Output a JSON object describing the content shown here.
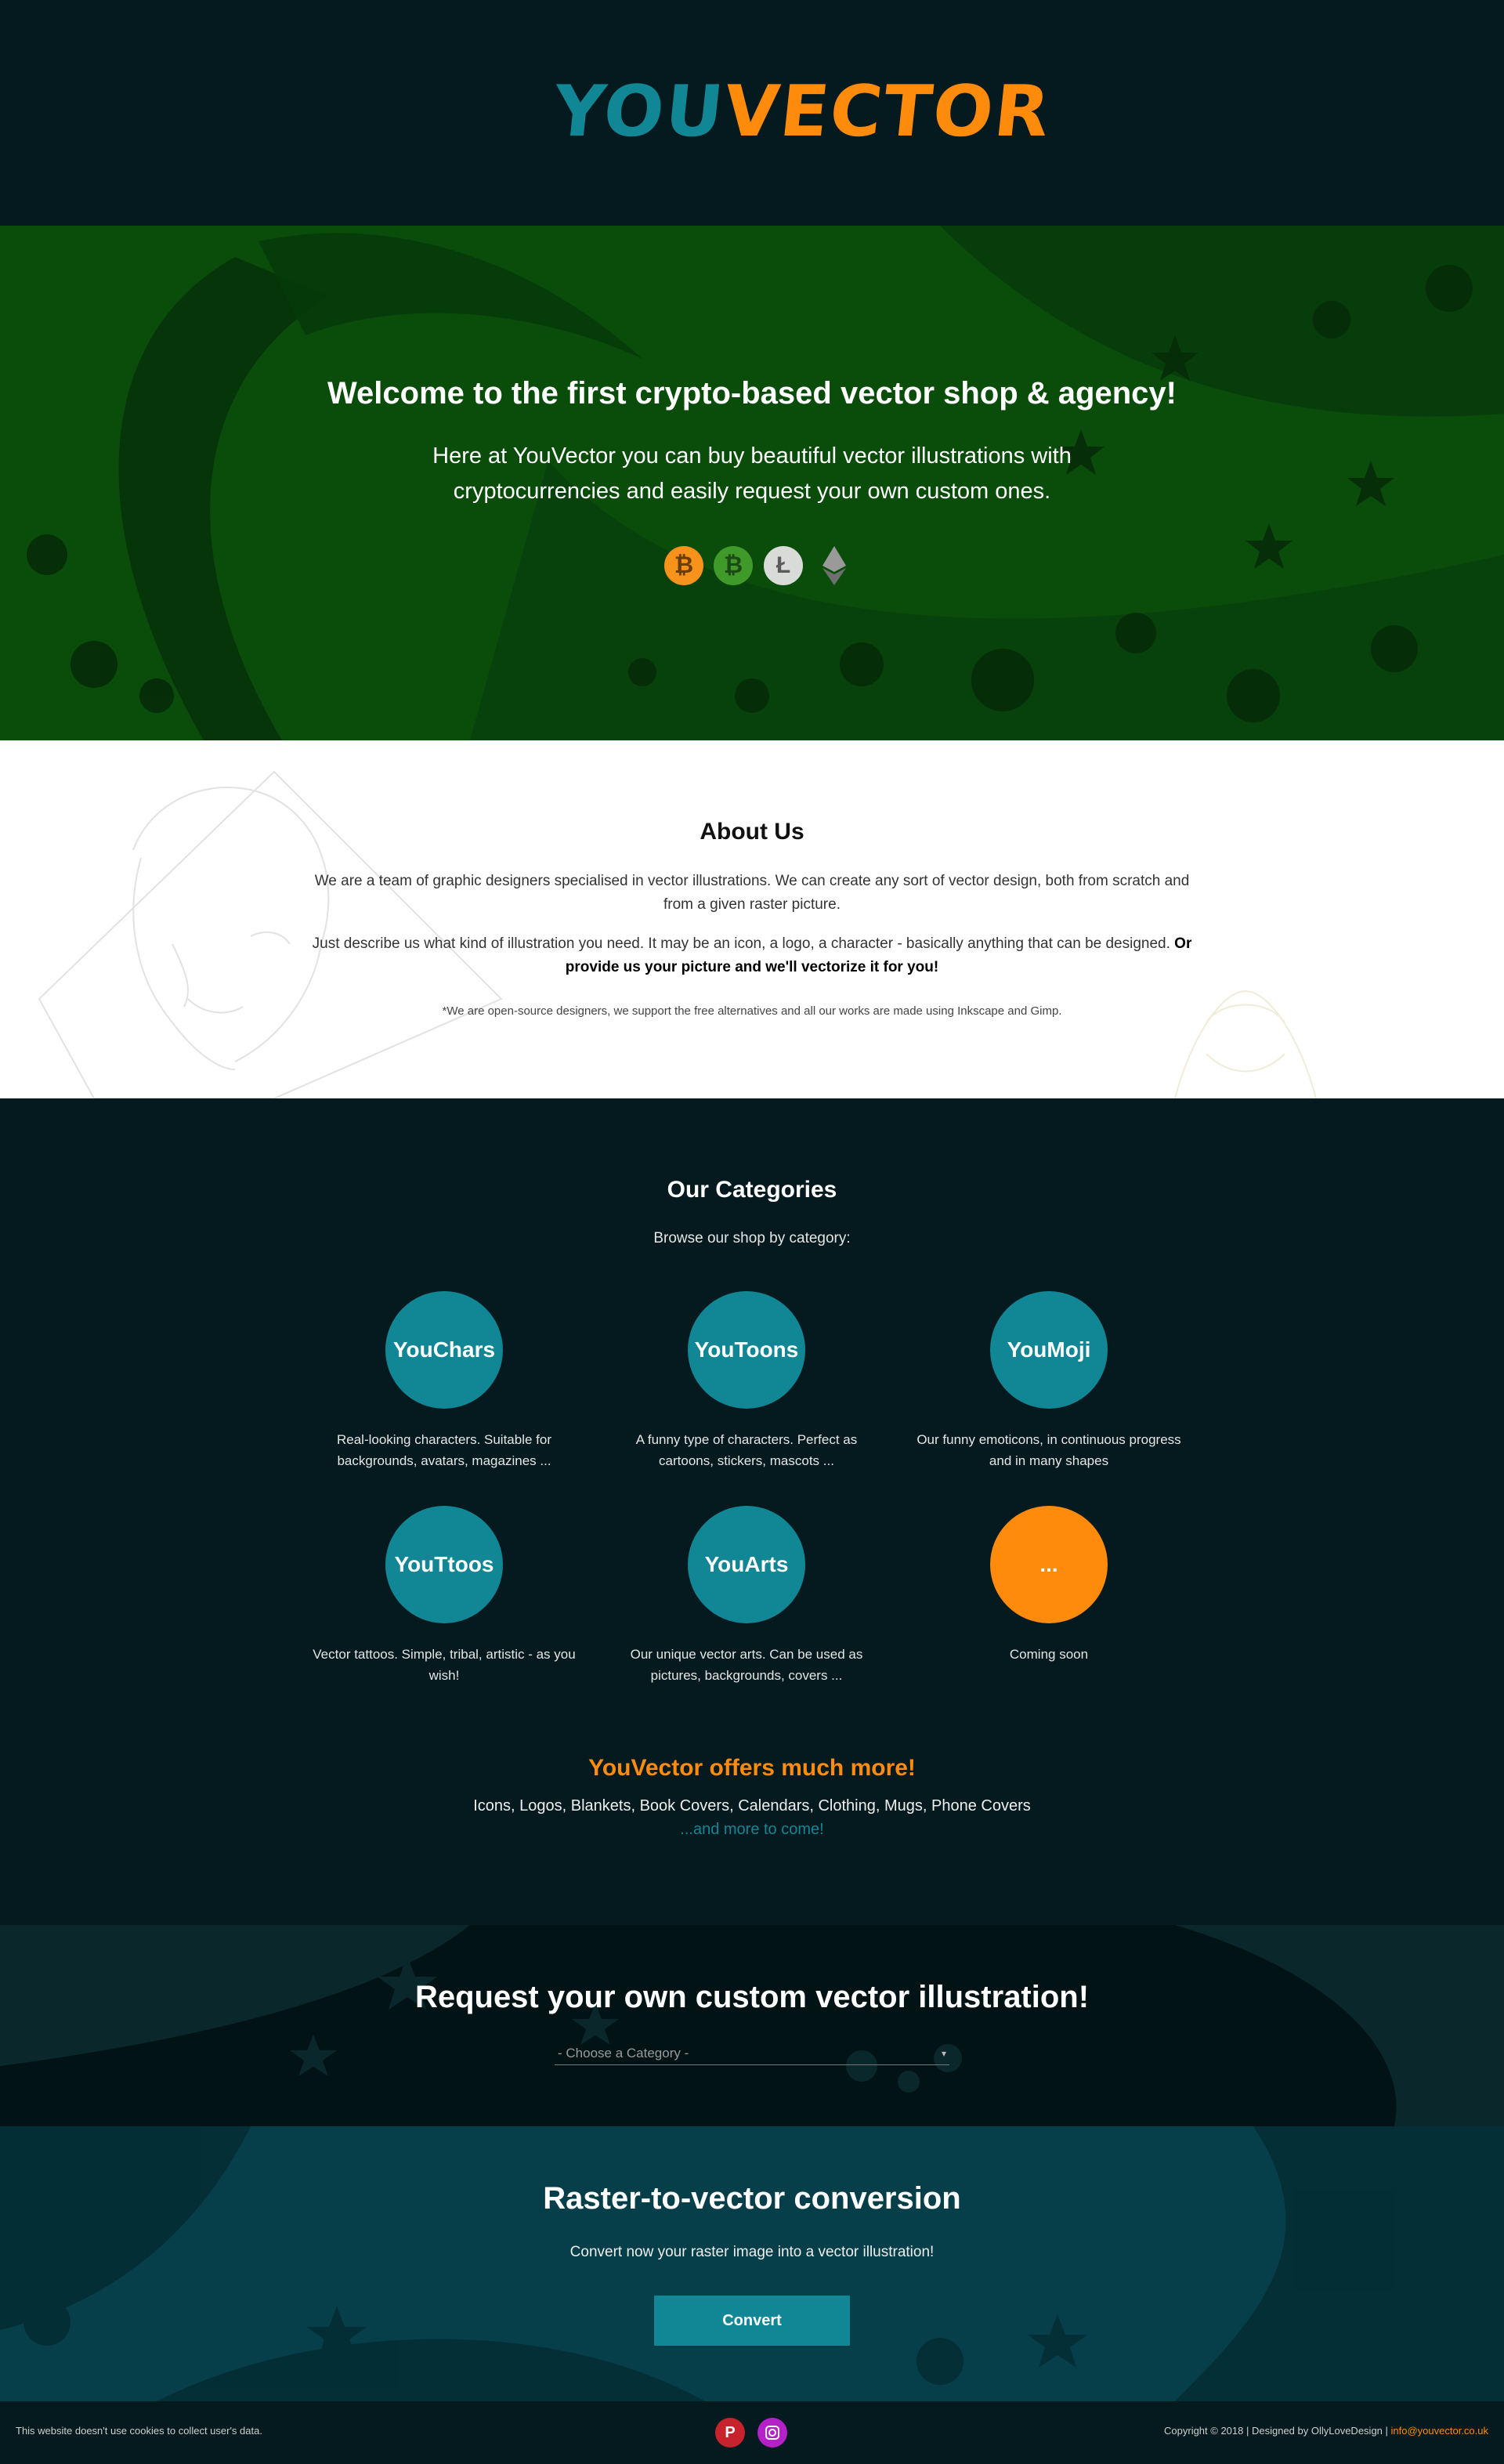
{
  "header": {
    "logo_part1": "YOU",
    "logo_part2": "VECTOR"
  },
  "hero": {
    "title": "Welcome to the first crypto-based vector shop & agency!",
    "subtitle": "Here at YouVector you can buy beautiful vector illustrations with cryptocurrencies and easily request your own custom ones.",
    "coins": [
      {
        "icon": "bitcoin-icon",
        "glyph": "₿",
        "color": "#f7931a"
      },
      {
        "icon": "bitcoin-cash-icon",
        "glyph": "₿",
        "color": "#3f9a2a"
      },
      {
        "icon": "litecoin-icon",
        "glyph": "Ł",
        "color": "#d9dbd9"
      },
      {
        "icon": "ethereum-icon",
        "glyph": "",
        "color": "#888888"
      }
    ]
  },
  "about": {
    "title": "About Us",
    "p1": "We are a team of graphic designers specialised in vector illustrations. We can create any sort of vector design, both from scratch and from a given raster picture.",
    "p2": "Just describe us what kind of illustration you need. It may be an icon, a logo, a character - basically anything that can be designed.",
    "p2_bold": "Or provide us your picture and we'll vectorize it for you!",
    "note": "*We are open-source designers, we support the free alternatives and all our works are made using Inkscape and Gimp."
  },
  "categories": {
    "title": "Our Categories",
    "lead": "Browse our shop by category:",
    "items": [
      {
        "name": "YouChars",
        "desc": "Real-looking characters. Suitable for backgrounds, avatars, magazines ..."
      },
      {
        "name": "YouToons",
        "desc": "A funny type of characters. Perfect as cartoons, stickers, mascots ..."
      },
      {
        "name": "YouMoji",
        "desc": "Our funny emoticons, in continuous progress and in many shapes"
      },
      {
        "name": "YouTtoos",
        "desc": "Vector tattoos. Simple, tribal, artistic - as you wish!"
      },
      {
        "name": "YouArts",
        "desc": "Our unique vector arts. Can be used as pictures, backgrounds, covers ..."
      },
      {
        "name": "...",
        "desc": "Coming soon"
      }
    ],
    "more_title": "YouVector offers much more!",
    "more_list": "Icons, Logos, Blankets, Book Covers, Calendars, Clothing, Mugs, Phone Covers",
    "more_link": "...and more to come!"
  },
  "request": {
    "title": "Request your own custom vector illustration!",
    "select_value": "- Choose a Category -",
    "caret": "▾"
  },
  "convert": {
    "title": "Raster-to-vector conversion",
    "lead": "Convert now your raster image into a vector illustration!",
    "button": "Convert"
  },
  "footer": {
    "cookie": "This website doesn't use cookies to collect user's data.",
    "copyright": "Copyright © 2018 | Designed by OllyLoveDesign |",
    "email": "info@youvector.co.uk"
  },
  "colors": {
    "dark_bg": "#041a1e",
    "teal": "#118795",
    "orange": "#ff8b0d",
    "hero_green": "#0a4d0a"
  }
}
